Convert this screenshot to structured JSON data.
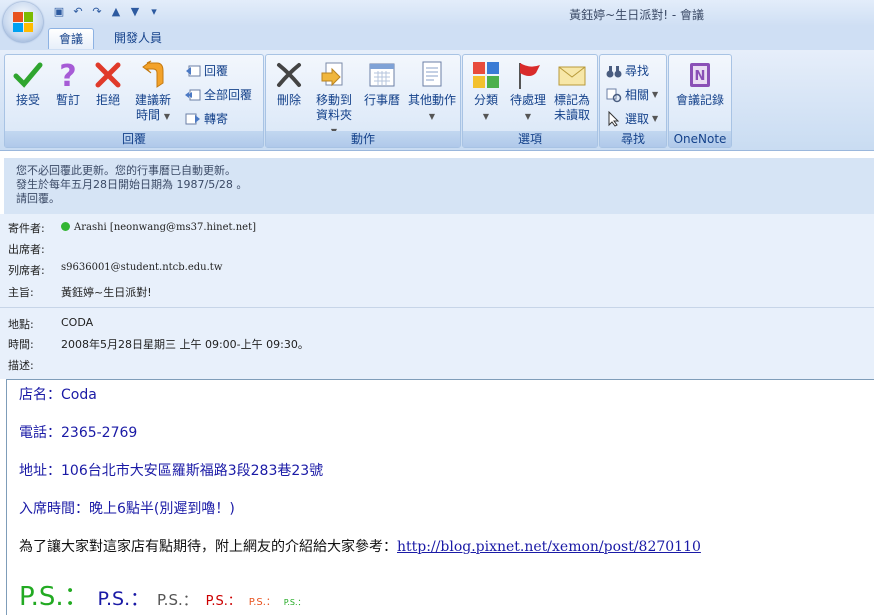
{
  "window_title": "黃鈺婷~生日派對! - 會議",
  "tabs": {
    "meeting": "會議",
    "dev": "開發人員"
  },
  "ribbon": {
    "respond": {
      "label": "回覆",
      "accept": "接受",
      "tentative": "暫訂",
      "decline": "拒絕",
      "propose_1": "建議新",
      "propose_2": "時間",
      "reply": "回覆",
      "reply_all": "全部回覆",
      "forward": "轉寄"
    },
    "actions": {
      "label": "動作",
      "delete": "刪除",
      "move_1": "移動到",
      "move_2": "資料夾",
      "calendar": "行事曆",
      "other": "其他動作"
    },
    "options": {
      "label": "選項",
      "categorize": "分類",
      "followup": "待處理",
      "mark_1": "標記為",
      "mark_2": "未讀取"
    },
    "find": {
      "label": "尋找",
      "find": "尋找",
      "related": "相關",
      "select": "選取"
    },
    "onenote": {
      "label": "OneNote",
      "notes": "會議記錄"
    }
  },
  "infobar": [
    "您不必回覆此更新。您的行事曆已自動更新。",
    "發生於每年五月28日開始日期為 1987/5/28 。",
    "請回覆。"
  ],
  "headers": {
    "from_label": "寄件者:",
    "from": "Arashi [neonwang@ms37.hinet.net]",
    "required_label": "出席者:",
    "required": "",
    "optional_label": "列席者:",
    "optional": "s9636001@student.ntcb.edu.tw",
    "subject_label": "主旨:",
    "subject": "黃鈺婷~生日派對!",
    "location_label": "地點:",
    "location": "CODA",
    "time_label": "時間:",
    "time": "2008年5月28日星期三 上午 09:00-上午 09:30。",
    "desc_label": "描述:"
  },
  "body": {
    "shop_label": "店名：",
    "shop": "Coda",
    "phone_label": "電話：",
    "phone": "2365-2769",
    "address_label": "地址：",
    "address": "106台北市大安區羅斯福路3段283巷23號",
    "time_label": "入席時間：",
    "time": "晚上6點半(別遲到嚕！)",
    "intro": "為了讓大家對這家店有點期待，附上網友的介紹給大家參考：",
    "link": "http://blog.pixnet.net/xemon/post/8270110",
    "ps": [
      "P.S.：",
      "P.S.：",
      "P.S.：",
      "P.S.：",
      "P.S.：",
      "P.S.："
    ]
  },
  "colors": {
    "ps": [
      "#22aa22",
      "#1a1aa6",
      "#555555",
      "#cc0000",
      "#e8531f",
      "#22aa22"
    ]
  }
}
